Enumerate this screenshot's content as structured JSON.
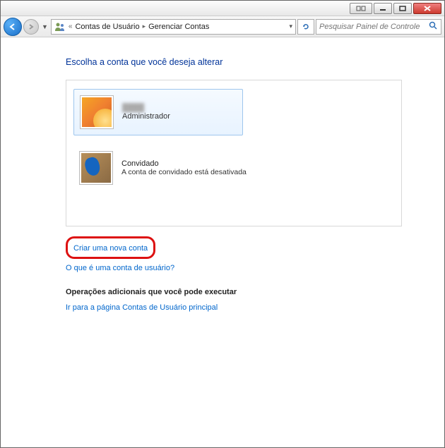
{
  "breadcrumb": {
    "level1": "Contas de Usuário",
    "level2": "Gerenciar Contas"
  },
  "search": {
    "placeholder": "Pesquisar Painel de Controle"
  },
  "heading": "Escolha a conta que você deseja alterar",
  "accounts": {
    "admin": {
      "name": "████",
      "role": "Administrador"
    },
    "guest": {
      "name": "Convidado",
      "desc": "A conta de convidado está desativada"
    }
  },
  "links": {
    "create": "Criar uma nova conta",
    "whatis": "O que é uma conta de usuário?",
    "section": "Operações adicionais que você pode executar",
    "main": "Ir para a página Contas de Usuário principal"
  }
}
